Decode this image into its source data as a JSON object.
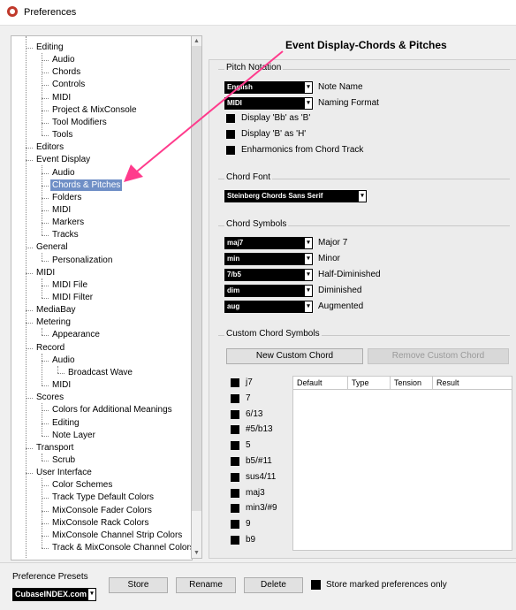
{
  "window": {
    "title": "Preferences"
  },
  "annotation": "Event Display-Chords & Pitches",
  "tree": [
    {
      "label": "Editing",
      "level": 0
    },
    {
      "label": "Audio",
      "level": 1
    },
    {
      "label": "Chords",
      "level": 1
    },
    {
      "label": "Controls",
      "level": 1
    },
    {
      "label": "MIDI",
      "level": 1
    },
    {
      "label": "Project & MixConsole",
      "level": 1
    },
    {
      "label": "Tool Modifiers",
      "level": 1
    },
    {
      "label": "Tools",
      "level": 1
    },
    {
      "label": "Editors",
      "level": 0
    },
    {
      "label": "Event Display",
      "level": 0
    },
    {
      "label": "Audio",
      "level": 1
    },
    {
      "label": "Chords & Pitches",
      "level": 1,
      "selected": true
    },
    {
      "label": "Folders",
      "level": 1
    },
    {
      "label": "MIDI",
      "level": 1
    },
    {
      "label": "Markers",
      "level": 1
    },
    {
      "label": "Tracks",
      "level": 1
    },
    {
      "label": "General",
      "level": 0
    },
    {
      "label": "Personalization",
      "level": 1
    },
    {
      "label": "MIDI",
      "level": 0
    },
    {
      "label": "MIDI File",
      "level": 1
    },
    {
      "label": "MIDI Filter",
      "level": 1
    },
    {
      "label": "MediaBay",
      "level": 0
    },
    {
      "label": "Metering",
      "level": 0
    },
    {
      "label": "Appearance",
      "level": 1
    },
    {
      "label": "Record",
      "level": 0
    },
    {
      "label": "Audio",
      "level": 1
    },
    {
      "label": "Broadcast Wave",
      "level": 2
    },
    {
      "label": "MIDI",
      "level": 1
    },
    {
      "label": "Scores",
      "level": 0
    },
    {
      "label": "Colors for Additional Meanings",
      "level": 1
    },
    {
      "label": "Editing",
      "level": 1
    },
    {
      "label": "Note Layer",
      "level": 1
    },
    {
      "label": "Transport",
      "level": 0
    },
    {
      "label": "Scrub",
      "level": 1
    },
    {
      "label": "User Interface",
      "level": 0
    },
    {
      "label": "Color Schemes",
      "level": 1
    },
    {
      "label": "Track Type Default Colors",
      "level": 1
    },
    {
      "label": "MixConsole Fader Colors",
      "level": 1
    },
    {
      "label": "MixConsole Rack Colors",
      "level": 1
    },
    {
      "label": "MixConsole Channel Strip Colors",
      "level": 1
    },
    {
      "label": "Track & MixConsole Channel Colors",
      "level": 1
    }
  ],
  "pitch_notation": {
    "title": "Pitch Notation",
    "note_name_value": "English",
    "note_name_label": "Note Name",
    "naming_format_value": "MIDI",
    "naming_format_label": "Naming Format",
    "checks": [
      "Display 'Bb' as 'B'",
      "Display 'B' as 'H'",
      "Enharmonics from Chord Track"
    ]
  },
  "chord_font": {
    "title": "Chord Font",
    "value": "Steinberg Chords Sans Serif"
  },
  "chord_symbols": {
    "title": "Chord Symbols",
    "rows": [
      {
        "value": "maj7",
        "label": "Major 7"
      },
      {
        "value": "min",
        "label": "Minor"
      },
      {
        "value": "7/b5",
        "label": "Half-Diminished"
      },
      {
        "value": "dim",
        "label": "Diminished"
      },
      {
        "value": "aug",
        "label": "Augmented"
      }
    ]
  },
  "custom_chords": {
    "title": "Custom Chord Symbols",
    "new_button": "New Custom Chord",
    "remove_button": "Remove Custom Chord",
    "items": [
      "j7",
      "7",
      "6/13",
      "#5/b13",
      "5",
      "b5/#11",
      "sus4/11",
      "maj3",
      "min3/#9",
      "9",
      "b9"
    ],
    "columns": [
      "Default",
      "Type",
      "Tension",
      "Result"
    ]
  },
  "presets": {
    "title": "Preference Presets",
    "value": "CubaseINDEX.com",
    "store": "Store",
    "rename": "Rename",
    "delete": "Delete",
    "store_marked": "Store marked preferences only"
  },
  "colors": {
    "selection": "#6f8fc6",
    "arrow": "#ff3b8c"
  }
}
